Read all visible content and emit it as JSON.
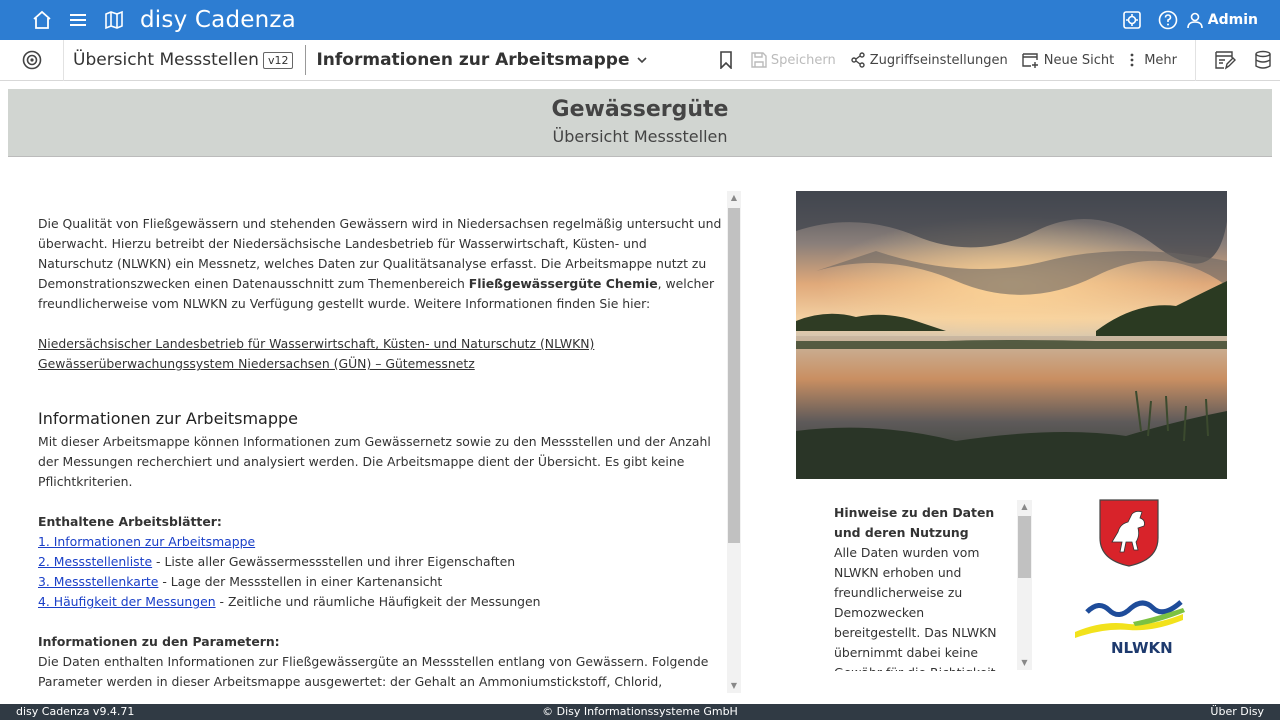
{
  "app": {
    "brand": "disy Cadenza",
    "user": "Admin"
  },
  "toolbar": {
    "title": "Übersicht Messstellen",
    "version": "v12",
    "sheet": "Informationen zur Arbeitsmappe",
    "save": "Speichern",
    "access": "Zugriffseinstellungen",
    "new_view": "Neue Sicht",
    "more": "Mehr"
  },
  "header": {
    "title": "Gewässergüte",
    "subtitle": "Übersicht Messstellen"
  },
  "content": {
    "intro_1": "Die Qualität von Fließgewässern und stehenden Gewässern wird in Niedersachsen regelmäßig untersucht und überwacht. Hierzu betreibt der Niedersächsische Landesbetrieb für Wasserwirtschaft, Küsten- und Naturschutz (NLWKN) ein Messnetz, welches Daten zur Qualitätsanalyse erfasst. Die Arbeitsmappe nutzt zu Demonstrationszwecken einen Datenausschnitt zum Themenbereich ",
    "intro_bold": "Fließgewässergüte Chemie",
    "intro_2": ", welcher freundlicherweise vom NLWKN zu Verfügung gestellt wurde. Weitere Informationen finden Sie hier:",
    "link_nlwkn": "Niedersächsischer Landesbetrieb für Wasserwirtschaft, Küsten- und Naturschutz (NLWKN)",
    "link_guen": "Gewässerüberwachungssystem Niedersachsen (GÜN) – Gütemessnetz",
    "info_heading": "Informationen zur Arbeitsmappe",
    "info_text": "Mit dieser Arbeitsmappe können Informationen zum Gewässernetz sowie zu den Messstellen und der Anzahl der Messungen recherchiert und analysiert werden. Die Arbeitsmappe dient der Übersicht. Es gibt keine Pflichtkriterien.",
    "sheets_heading": "Enthaltene Arbeitsblätter:",
    "sheets": [
      {
        "link": "1. Informationen zur Arbeitsmappe",
        "desc": ""
      },
      {
        "link": "2. Messstellenliste",
        "desc": " - Liste aller Gewässermessstellen und ihrer Eigenschaften"
      },
      {
        "link": "3. Messstellenkarte",
        "desc": " - Lage der Messstellen in einer Kartenansicht"
      },
      {
        "link": "4. Häufigkeit der Messungen",
        "desc": " - Zeitliche und räumliche Häufigkeit der Messungen"
      }
    ],
    "params_heading": "Informationen zu den Parametern:",
    "params_text": "Die Daten enthalten Informationen zur Fließgewässergüte an Messstellen entlang von Gewässern. Folgende Parameter werden in dieser Arbeitsmappe ausgewertet: der Gehalt an Ammoniumstickstoff, Chlorid, Nitratstickstoff,  Nitritstickstoff, Sulfat und Sauerstoff, sowie der pH-Wert, die Elektrische Leitfähigkeit und die"
  },
  "notes": {
    "heading": "Hinweise zu den Daten und deren Nutzung",
    "text": "Alle Daten wurden vom NLWKN erhoben und freundlicherweise zu Demozwecken bereitgestellt. Das NLWKN übernimmt dabei keine Gewähr für die Richtigkeit der Daten. Bei den"
  },
  "logos": {
    "nlwkn": "NLWKN"
  },
  "footer": {
    "version": "disy Cadenza v9.4.71",
    "copyright": "© Disy Informationssysteme GmbH",
    "about": "Über Disy"
  },
  "colors": {
    "topbar": "#2d7dd2",
    "band": "#d1d5d1",
    "link": "#1a3fc7",
    "footer": "#303a44"
  }
}
